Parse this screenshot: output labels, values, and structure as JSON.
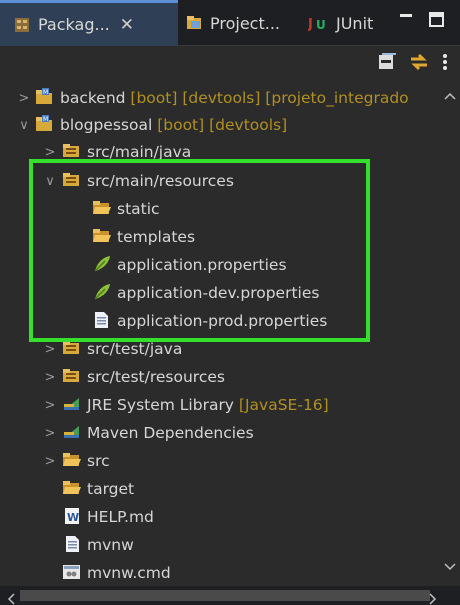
{
  "tabs": [
    {
      "label": "Packag...",
      "icon": "package-explorer-icon"
    },
    {
      "label": "Project...",
      "icon": "project-explorer-icon"
    },
    {
      "label": "JUnit",
      "icon": "junit-icon"
    }
  ],
  "toolbar": {
    "collapse_icon": "collapse-all-icon",
    "link_icon": "link-with-editor-icon",
    "menu_icon": "view-menu-icon"
  },
  "tree": [
    {
      "name": "backend",
      "decoration": " [boot] [devtools] [projeto_integrado",
      "arrow": "collapsed",
      "icon": "project-icon"
    },
    {
      "name": "blogpessoal",
      "decoration": " [boot] [devtools]",
      "arrow": "expanded",
      "icon": "project-icon"
    },
    {
      "name": "src/main/java",
      "decoration": "",
      "arrow": "collapsed",
      "icon": "source-folder-icon"
    },
    {
      "name": "src/main/resources",
      "decoration": "",
      "arrow": "expanded",
      "icon": "source-folder-icon"
    },
    {
      "name": "static",
      "decoration": "",
      "arrow": "none",
      "icon": "folder-icon"
    },
    {
      "name": "templates",
      "decoration": "",
      "arrow": "none",
      "icon": "folder-icon"
    },
    {
      "name": "application.properties",
      "decoration": "",
      "arrow": "none",
      "icon": "properties-file-icon"
    },
    {
      "name": "application-dev.properties",
      "decoration": "",
      "arrow": "none",
      "icon": "properties-file-icon"
    },
    {
      "name": "application-prod.properties",
      "decoration": "",
      "arrow": "none",
      "icon": "text-file-icon"
    },
    {
      "name": "src/test/java",
      "decoration": "",
      "arrow": "collapsed",
      "icon": "source-folder-icon"
    },
    {
      "name": "src/test/resources",
      "decoration": "",
      "arrow": "collapsed",
      "icon": "source-folder-icon"
    },
    {
      "name": "JRE System Library",
      "decoration": " [JavaSE-16]",
      "arrow": "collapsed",
      "icon": "library-icon"
    },
    {
      "name": "Maven Dependencies",
      "decoration": "",
      "arrow": "collapsed",
      "icon": "library-icon"
    },
    {
      "name": "src",
      "decoration": "",
      "arrow": "collapsed",
      "icon": "folder-icon"
    },
    {
      "name": "target",
      "decoration": "",
      "arrow": "none",
      "icon": "folder-icon"
    },
    {
      "name": "HELP.md",
      "decoration": "",
      "arrow": "none",
      "icon": "word-document-icon"
    },
    {
      "name": "mvnw",
      "decoration": "",
      "arrow": "none",
      "icon": "text-file-icon"
    },
    {
      "name": "mvnw.cmd",
      "decoration": "",
      "arrow": "none",
      "icon": "cmd-file-icon"
    }
  ],
  "colors": {
    "highlight": "#35e02c",
    "decoration": "#b09020",
    "background": "#2b2b2b"
  }
}
